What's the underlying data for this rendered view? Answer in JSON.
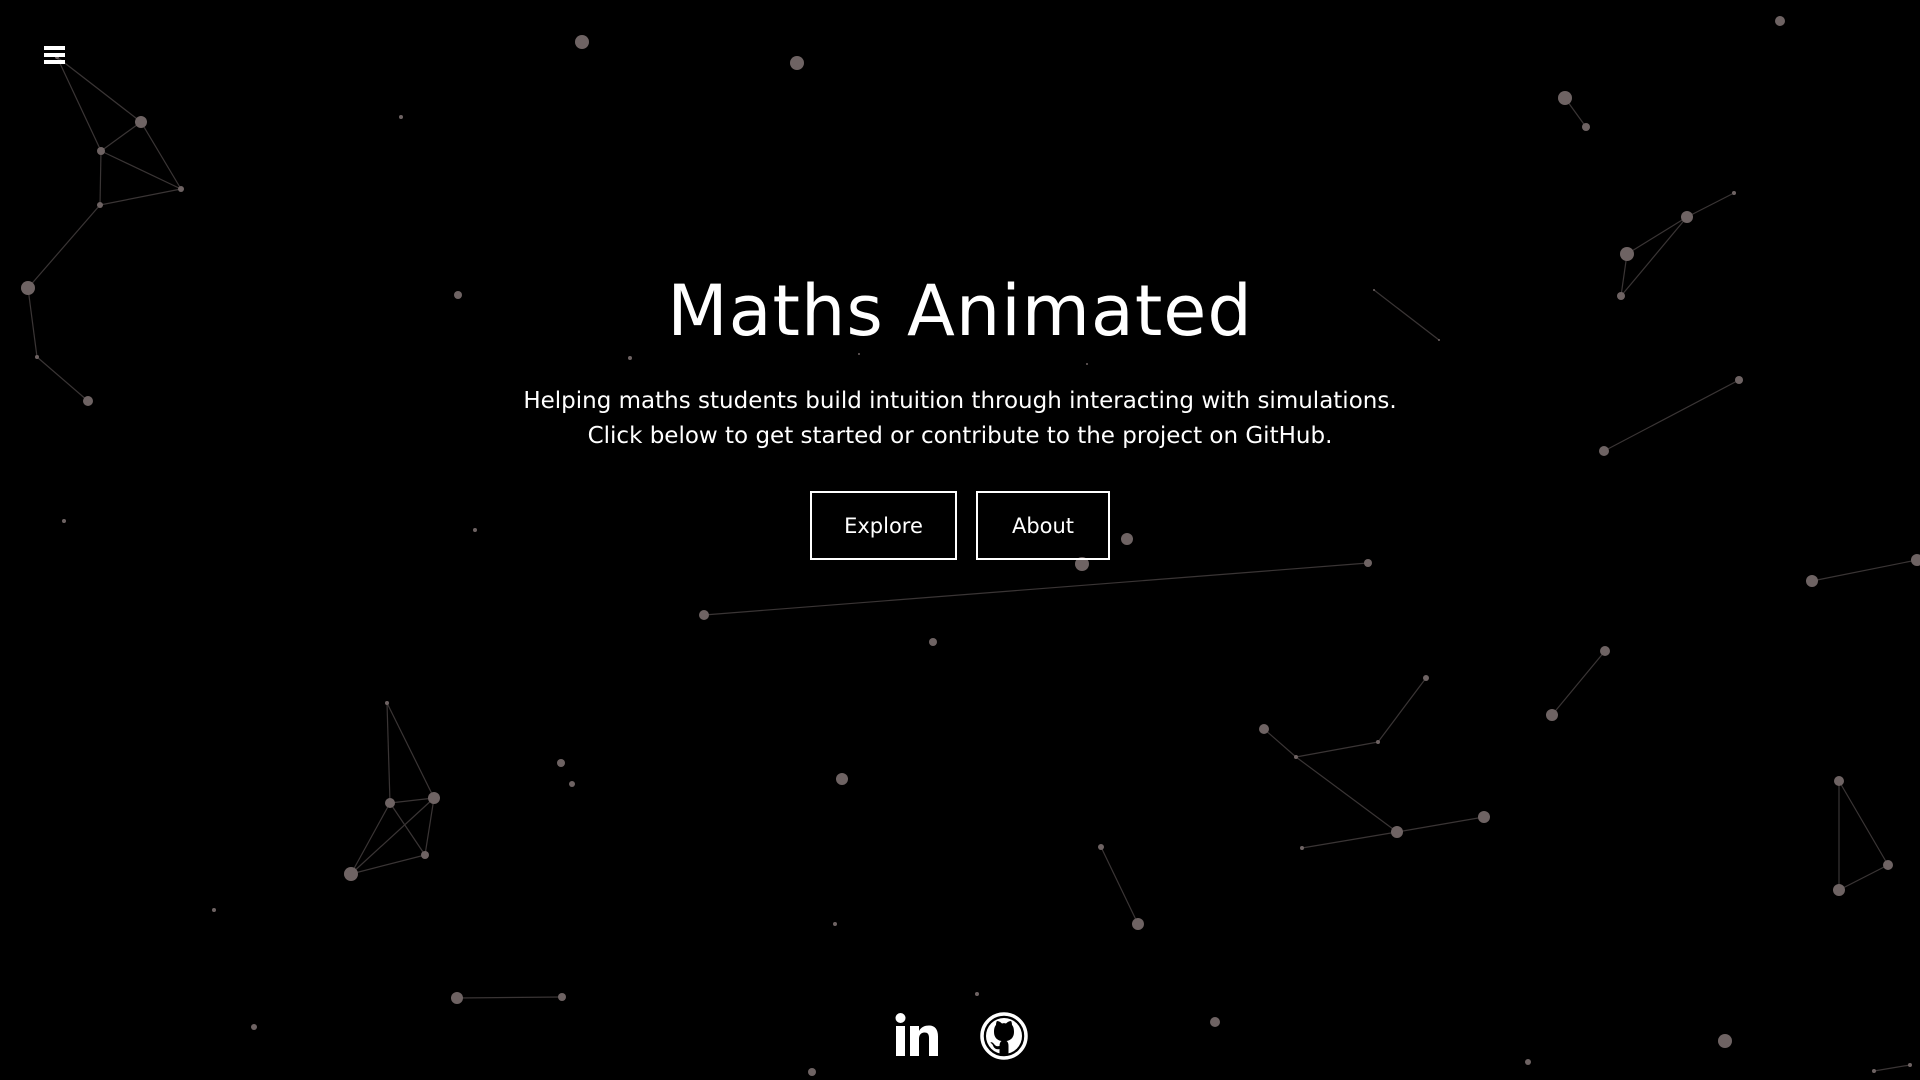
{
  "colors": {
    "background": "#000000",
    "text": "#ffffff",
    "particle": "#6e6363",
    "line": "#3a3535"
  },
  "nav": {
    "menu_icon": "hamburger-menu-icon"
  },
  "hero": {
    "title": "Maths Animated",
    "subtitle_line1": "Helping maths students build intuition through interacting with simulations.",
    "subtitle_line2": "Click below to get started or contribute to the project on GitHub."
  },
  "buttons": {
    "explore_label": "Explore",
    "about_label": "About"
  },
  "social": {
    "linkedin_icon": "linkedin-icon",
    "github_icon": "github-icon"
  }
}
